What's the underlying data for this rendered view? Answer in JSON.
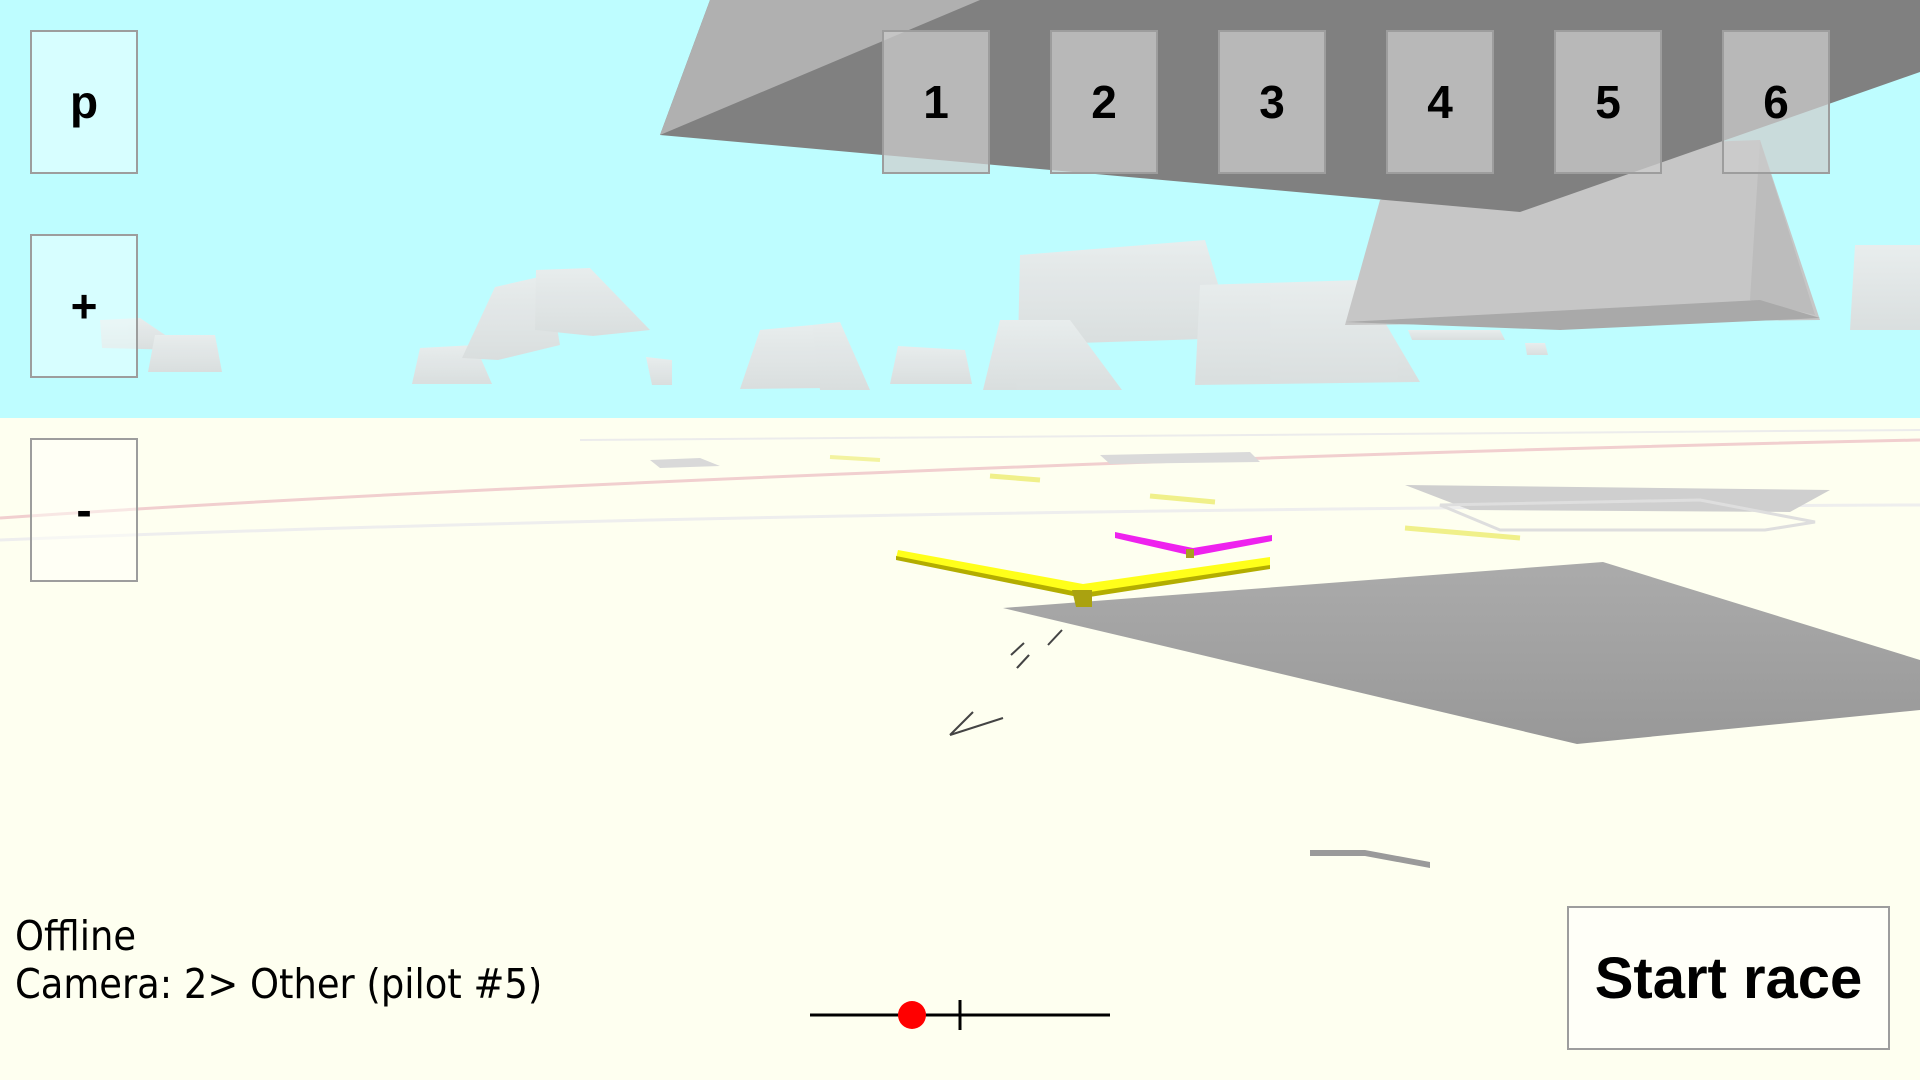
{
  "colors": {
    "sky": "#befdff",
    "ground": "#fefff0",
    "slab_dark": "#808080",
    "slab_light": "#b0b0b0",
    "cloud": "#e2e2e2",
    "player_plane": "#ffff1a",
    "other_plane": "#ee22ee",
    "slider_marker": "#ff0000"
  },
  "side_controls": {
    "pause_label": "p",
    "zoom_in_label": "+",
    "zoom_out_label": "-"
  },
  "camera_buttons": [
    {
      "label": "1"
    },
    {
      "label": "2"
    },
    {
      "label": "3"
    },
    {
      "label": "4"
    },
    {
      "label": "5"
    },
    {
      "label": "6"
    }
  ],
  "status": {
    "connection": "Offline",
    "camera": "Camera: 2> Other (pilot #5)"
  },
  "slider": {
    "value_fraction": 0.34,
    "center_fraction": 0.5
  },
  "start_race_label": "Start race"
}
